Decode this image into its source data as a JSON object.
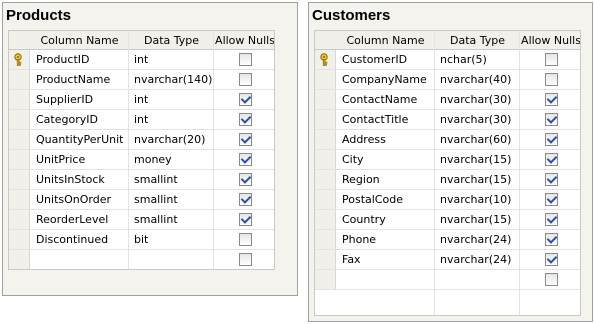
{
  "columns": [
    "Column Name",
    "Data Type",
    "Allow Nulls"
  ],
  "tables": [
    {
      "title": "Products",
      "rows": [
        {
          "name": "ProductID",
          "type": "int",
          "nulls": false,
          "key": true
        },
        {
          "name": "ProductName",
          "type": "nvarchar(140)",
          "nulls": false,
          "key": false
        },
        {
          "name": "SupplierID",
          "type": "int",
          "nulls": true,
          "key": false
        },
        {
          "name": "CategoryID",
          "type": "int",
          "nulls": true,
          "key": false
        },
        {
          "name": "QuantityPerUnit",
          "type": "nvarchar(20)",
          "nulls": true,
          "key": false
        },
        {
          "name": "UnitPrice",
          "type": "money",
          "nulls": true,
          "key": false
        },
        {
          "name": "UnitsInStock",
          "type": "smallint",
          "nulls": true,
          "key": false
        },
        {
          "name": "UnitsOnOrder",
          "type": "smallint",
          "nulls": true,
          "key": false
        },
        {
          "name": "ReorderLevel",
          "type": "smallint",
          "nulls": true,
          "key": false
        },
        {
          "name": "Discontinued",
          "type": "bit",
          "nulls": false,
          "key": false
        },
        {
          "name": "",
          "type": "",
          "nulls": false,
          "key": false
        }
      ]
    },
    {
      "title": "Customers",
      "rows": [
        {
          "name": "CustomerID",
          "type": "nchar(5)",
          "nulls": false,
          "key": true
        },
        {
          "name": "CompanyName",
          "type": "nvarchar(40)",
          "nulls": false,
          "key": false
        },
        {
          "name": "ContactName",
          "type": "nvarchar(30)",
          "nulls": true,
          "key": false
        },
        {
          "name": "ContactTitle",
          "type": "nvarchar(30)",
          "nulls": true,
          "key": false
        },
        {
          "name": "Address",
          "type": "nvarchar(60)",
          "nulls": true,
          "key": false
        },
        {
          "name": "City",
          "type": "nvarchar(15)",
          "nulls": true,
          "key": false
        },
        {
          "name": "Region",
          "type": "nvarchar(15)",
          "nulls": true,
          "key": false
        },
        {
          "name": "PostalCode",
          "type": "nvarchar(10)",
          "nulls": true,
          "key": false
        },
        {
          "name": "Country",
          "type": "nvarchar(15)",
          "nulls": true,
          "key": false
        },
        {
          "name": "Phone",
          "type": "nvarchar(24)",
          "nulls": true,
          "key": false
        },
        {
          "name": "Fax",
          "type": "nvarchar(24)",
          "nulls": true,
          "key": false
        },
        {
          "name": "",
          "type": "",
          "nulls": false,
          "key": false
        }
      ]
    }
  ]
}
